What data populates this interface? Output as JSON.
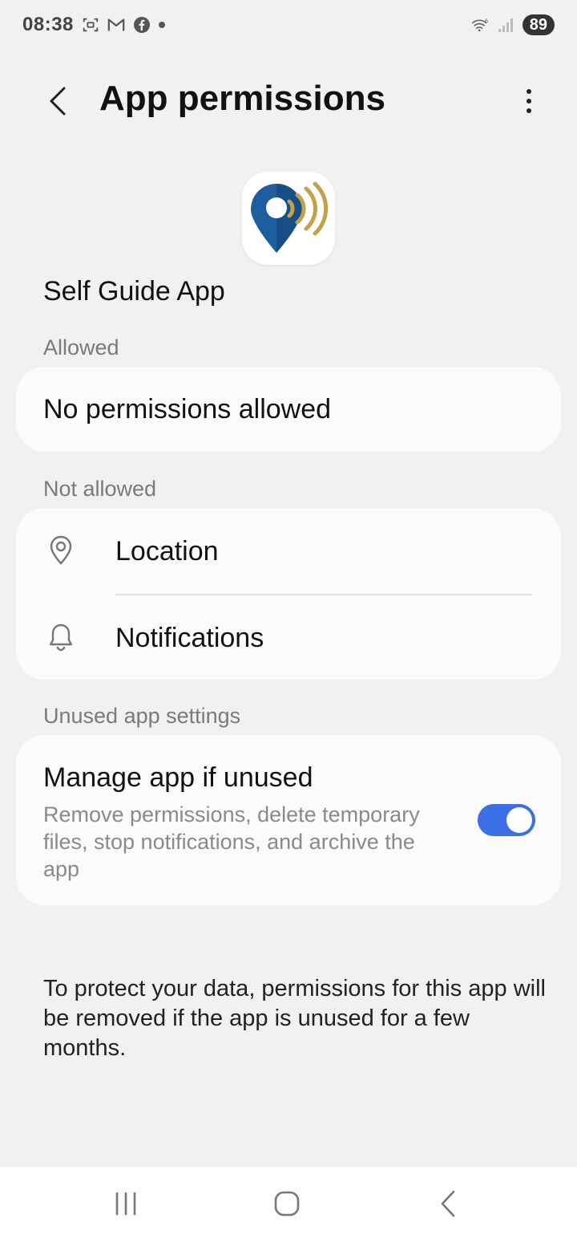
{
  "status_bar": {
    "time": "08:38",
    "battery": "89",
    "icons": [
      "screenshot-icon",
      "gmail-icon",
      "facebook-icon",
      "dot-icon",
      "wifi-icon",
      "signal-icon",
      "battery-icon"
    ]
  },
  "header": {
    "title": "App permissions",
    "back_icon": "back-arrow-icon",
    "more_icon": "more-vert-icon"
  },
  "app": {
    "name": "Self Guide App",
    "icon": "app-location-icon"
  },
  "allowed": {
    "label": "Allowed",
    "empty_text": "No permissions allowed"
  },
  "not_allowed": {
    "label": "Not allowed",
    "items": [
      {
        "label": "Location",
        "icon": "location-icon"
      },
      {
        "label": "Notifications",
        "icon": "bell-icon"
      }
    ]
  },
  "unused": {
    "label": "Unused app settings",
    "title": "Manage app if unused",
    "description": "Remove permissions, delete temporary files, stop notifications, and archive the app",
    "toggle_on": true
  },
  "footer_note": "To protect your data, permissions for this app will be removed if the app is unused for a few months.",
  "colors": {
    "background": "#f1f1f3",
    "card": "#fbfbfd",
    "accent": "#3a6fe6",
    "app_blue": "#1d5e9e",
    "app_gold": "#c3a14b"
  },
  "nav": {
    "icons": [
      "recent-apps-icon",
      "home-icon",
      "back-icon"
    ]
  }
}
